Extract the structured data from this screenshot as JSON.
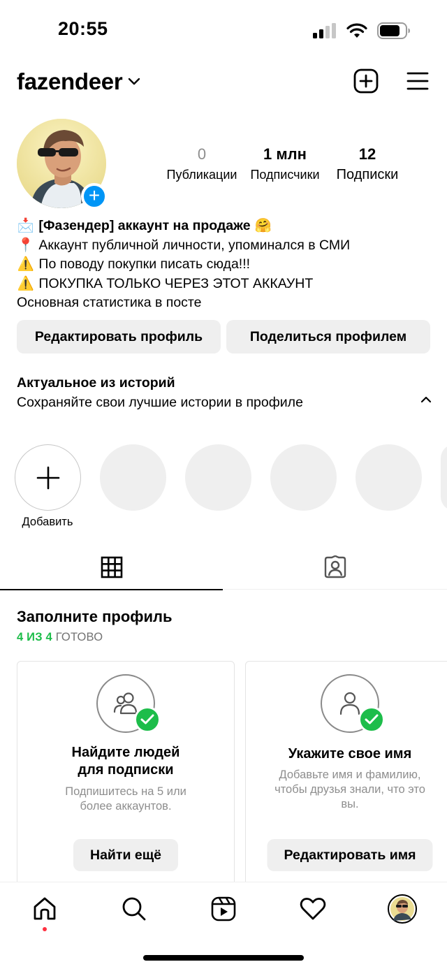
{
  "status_bar": {
    "time": "20:55",
    "icons": [
      "cellular-signal-icon",
      "wifi-icon",
      "battery-icon"
    ]
  },
  "header": {
    "username": "fazendeer",
    "icons": [
      "chevron-down-icon",
      "new-post-icon",
      "menu-icon"
    ]
  },
  "profile": {
    "stats": [
      {
        "value": "0",
        "label": "Публикации"
      },
      {
        "value": "1 млн",
        "label": "Подписчики"
      },
      {
        "value": "12",
        "label": "Подписки"
      }
    ],
    "bio": {
      "line1": "[Фазендер] аккаунт на продаже",
      "line2": "Аккаунт публичной личности, упоминался в СМИ",
      "line3": "По поводу покупки писать сюда!!!",
      "line4": "ПОКУПКА ТОЛЬКО ЧЕРЕЗ ЭТОТ АККАУНТ",
      "line5": "Основная статистика в посте",
      "emoji": {
        "envelope": "📩",
        "hug": "🤗",
        "pin": "📍",
        "warning": "⚠️"
      }
    },
    "edit_button": "Редактировать профиль",
    "share_button": "Поделиться профилем"
  },
  "highlights": {
    "title": "Актуальное из историй",
    "subtitle": "Сохраняйте свои лучшие истории в профиле",
    "add_label": "Добавить"
  },
  "tabs": [
    {
      "name": "posts-grid",
      "icon": "grid-icon",
      "active": true
    },
    {
      "name": "tagged",
      "icon": "tagged-person-icon",
      "active": false
    }
  ],
  "complete_profile": {
    "title": "Заполните профиль",
    "progress_done": "4 ИЗ 4",
    "progress_suffix": "ГОТОВО",
    "cards": [
      {
        "title_line1": "Найдите людей",
        "title_line2": "для подписки",
        "desc_line1": "Подпишитесь на 5 или",
        "desc_line2": "более аккаунтов.",
        "button": "Найти ещё"
      },
      {
        "title_line1": "Укажите свое имя",
        "desc_line1": "Добавьте имя и фамилию,",
        "desc_line2": "чтобы друзья знали, что это",
        "desc_line3": "вы.",
        "button": "Редактировать имя"
      }
    ]
  },
  "bottom_nav": [
    "home-icon",
    "search-icon",
    "reels-icon",
    "heart-icon",
    "profile-avatar"
  ],
  "colors": {
    "accent_blue": "#0095f6",
    "success_green": "#1dbd4a",
    "notification_red": "#ff3040",
    "button_gray": "#efefef"
  }
}
